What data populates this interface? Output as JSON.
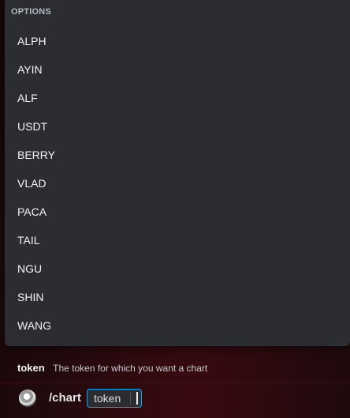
{
  "autocomplete": {
    "header": "OPTIONS",
    "options": [
      {
        "label": "ALPH"
      },
      {
        "label": "AYIN"
      },
      {
        "label": "ALF"
      },
      {
        "label": "USDT"
      },
      {
        "label": "BERRY"
      },
      {
        "label": "VLAD"
      },
      {
        "label": "PACA"
      },
      {
        "label": "TAIL"
      },
      {
        "label": "NGU"
      },
      {
        "label": "SHIN"
      },
      {
        "label": "WANG"
      }
    ]
  },
  "option_hint": {
    "name": "token",
    "description": "The token for which you want a chart"
  },
  "input": {
    "command": "/chart",
    "option_chip": "token",
    "avatar_icon": "app-avatar-icon"
  },
  "colors": {
    "popup_bg": "#2b2d31",
    "focus_border": "#00a8fc",
    "background": "#1b0a0c"
  }
}
